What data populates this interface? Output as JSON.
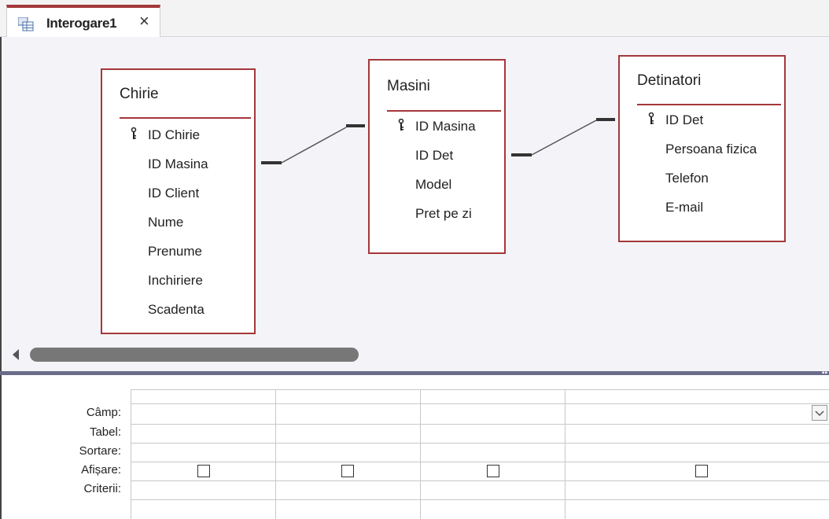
{
  "tab": {
    "title": "Interogare1",
    "close": "×"
  },
  "tables": {
    "chirie": {
      "title": "Chirie",
      "fields": [
        "ID Chirie",
        "ID Masina",
        "ID Client",
        "Nume",
        "Prenume",
        "Inchiriere",
        "Scadenta"
      ]
    },
    "masini": {
      "title": "Masini",
      "fields": [
        "ID Masina",
        "ID Det",
        "Model",
        "Pret pe zi"
      ]
    },
    "detinatori": {
      "title": "Detinatori",
      "fields": [
        "ID Det",
        "Persoana fizica",
        "Telefon",
        "E-mail"
      ]
    }
  },
  "grid": {
    "rows": [
      "Câmp:",
      "Tabel:",
      "Sortare:",
      "Afișare:",
      "Criterii:"
    ]
  },
  "colors": {
    "accent": "#a4373a",
    "splitter": "#6b6b8a"
  },
  "icons": [
    "query-icon",
    "key-icon",
    "close-icon",
    "dropdown-icon"
  ]
}
